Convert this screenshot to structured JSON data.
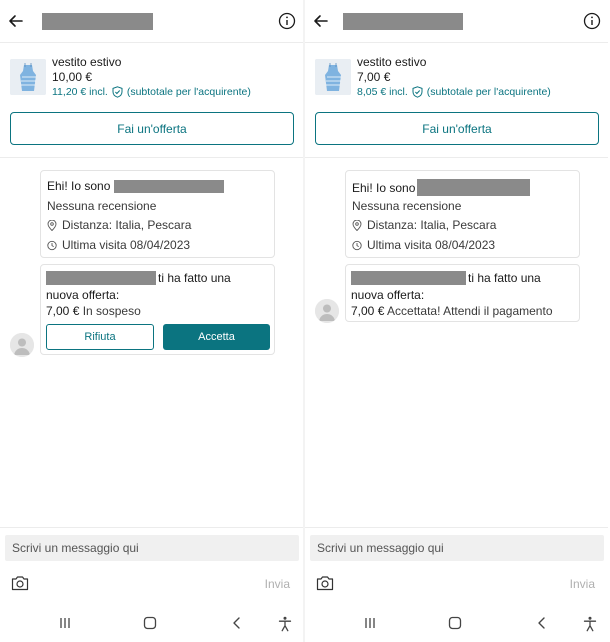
{
  "panels": [
    {
      "product": {
        "title": "vestito estivo",
        "price": "10,00 €",
        "incl_price": "11,20 € incl.",
        "buyer_subtotal": "(subtotale per l'acquirente)"
      },
      "offer_button": "Fai un'offerta",
      "profile": {
        "greeting": "Ehi! Io sono",
        "reviews": "Nessuna recensione",
        "distance": "Distanza: Italia, Pescara",
        "last_visit": "Ultima visita 08/04/2023"
      },
      "offer": {
        "made_offer": "ti ha fatto una",
        "new_offer": "nuova offerta:",
        "amount": "7,00 €",
        "status": "In sospeso",
        "decline_label": "Rifiuta",
        "accept_label": "Accetta"
      },
      "composer": {
        "placeholder": "Scrivi un messaggio qui",
        "send_label": "Invia"
      }
    },
    {
      "product": {
        "title": "vestito estivo",
        "price": "7,00 €",
        "incl_price": "8,05 € incl.",
        "buyer_subtotal": "(subtotale per l'acquirente)"
      },
      "offer_button": "Fai un'offerta",
      "profile": {
        "greeting": "Ehi! Io sono",
        "reviews": "Nessuna recensione",
        "distance": "Distanza: Italia, Pescara",
        "last_visit": "Ultima visita 08/04/2023"
      },
      "offer": {
        "made_offer": "ti ha fatto una",
        "new_offer": "nuova offerta:",
        "amount": "7,00 €",
        "status": "Accettata! Attendi il pagamento"
      },
      "composer": {
        "placeholder": "Scrivi un messaggio qui",
        "send_label": "Invia"
      }
    }
  ],
  "icons": [
    "back-arrow-icon",
    "info-icon",
    "shield-icon",
    "location-pin-icon",
    "clock-icon",
    "avatar-icon",
    "camera-icon",
    "nav-recents-icon",
    "nav-home-icon",
    "nav-back-icon",
    "accessibility-icon"
  ],
  "colors": {
    "accent": "#0b7480",
    "redaction": "#8a8a8a",
    "input_bg": "#f0f0f0"
  }
}
